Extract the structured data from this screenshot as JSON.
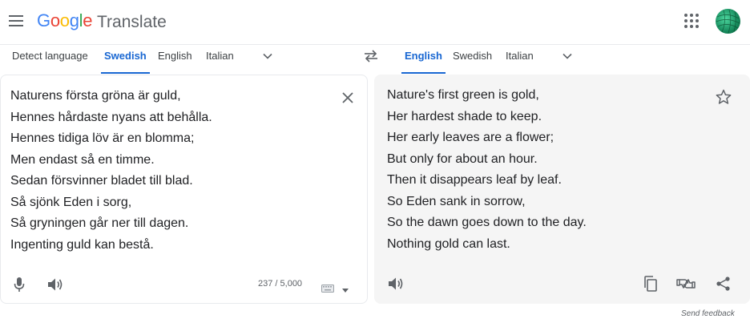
{
  "header": {
    "logo_letters": [
      {
        "ch": "G",
        "cls": "g-blue"
      },
      {
        "ch": "o",
        "cls": "g-red"
      },
      {
        "ch": "o",
        "cls": "g-yellow"
      },
      {
        "ch": "g",
        "cls": "g-blue"
      },
      {
        "ch": "l",
        "cls": "g-green"
      },
      {
        "ch": "e",
        "cls": "g-red"
      }
    ],
    "logo_word": "Translate",
    "icons": [
      "menu-icon",
      "apps-grid-icon",
      "avatar"
    ]
  },
  "source": {
    "tabs": [
      "Detect language",
      "Swedish",
      "English",
      "Italian"
    ],
    "active_tab": "Swedish",
    "text": [
      "Naturens första gröna är guld,",
      "Hennes hårdaste nyans att behålla.",
      "Hennes tidiga löv är en blomma;",
      "Men endast så en timme.",
      "Sedan försvinner bladet till blad.",
      "Så sjönk Eden i sorg,",
      "Så gryningen går ner till dagen.",
      "Ingenting guld kan bestå."
    ],
    "char_count": "237 / 5,000"
  },
  "target": {
    "tabs": [
      "English",
      "Swedish",
      "Italian"
    ],
    "active_tab": "English",
    "text": [
      "Nature's first green is gold,",
      "Her hardest shade to keep.",
      "Her early leaves are a flower;",
      "But only for about an hour.",
      "Then it disappears leaf by leaf.",
      "So Eden sank in sorrow,",
      "So the dawn goes down to the day.",
      "Nothing gold can last."
    ]
  },
  "footer": {
    "feedback": "Send feedback"
  },
  "colors": {
    "accent": "#1967d2",
    "icon": "#5f6368",
    "target_bg": "#f5f5f5"
  }
}
